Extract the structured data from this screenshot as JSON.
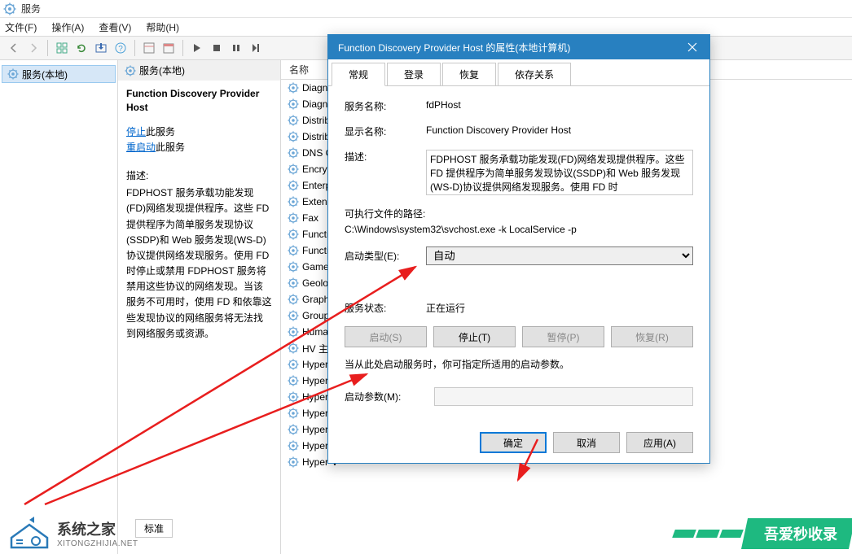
{
  "window": {
    "title": "服务",
    "menu": {
      "file": "文件(F)",
      "action": "操作(A)",
      "view": "查看(V)",
      "help": "帮助(H)"
    }
  },
  "tree": {
    "root": "服务(本地)"
  },
  "detail": {
    "header": "服务(本地)",
    "title": "Function Discovery Provider Host",
    "stop_link": "停止",
    "stop_suffix": "此服务",
    "restart_link": "重启动",
    "restart_suffix": "此服务",
    "desc_label": "描述:",
    "desc": "FDPHOST 服务承载功能发现(FD)网络发现提供程序。这些 FD 提供程序为简单服务发现协议(SSDP)和 Web 服务发现(WS-D)协议提供网络发现服务。使用 FD 时停止或禁用 FDPHOST 服务将禁用这些协议的网络发现。当该服务不可用时，使用 FD 和依靠这些发现协议的网络服务将无法找到网络服务或资源。"
  },
  "list": {
    "col_name": "名称",
    "items": [
      "Diagno",
      "Diagno",
      "Distribu",
      "Distribu",
      "DNS Cli",
      "Encrypt",
      "Enterpr",
      "Extensil",
      "Fax",
      "Functio",
      "Functio",
      "GameD",
      "Geoloc",
      "Graphi",
      "Group I",
      "Human",
      "HV 主机",
      "Hyper-",
      "Hyper-V",
      "Hyper-V",
      "Hyper-V",
      "Hyper-V",
      "Hyper-V",
      "Hyper-V"
    ]
  },
  "dialog": {
    "title": "Function Discovery Provider Host 的属性(本地计算机)",
    "tabs": {
      "general": "常规",
      "logon": "登录",
      "recovery": "恢复",
      "deps": "依存关系"
    },
    "svc_name_lbl": "服务名称:",
    "svc_name": "fdPHost",
    "disp_name_lbl": "显示名称:",
    "disp_name": "Function Discovery Provider Host",
    "desc_lbl": "描述:",
    "desc": "FDPHOST 服务承载功能发现(FD)网络发现提供程序。这些 FD 提供程序为简单服务发现协议(SSDP)和 Web 服务发现(WS-D)协议提供网络发现服务。使用 FD 时",
    "exe_lbl": "可执行文件的路径:",
    "exe": "C:\\Windows\\system32\\svchost.exe -k LocalService -p",
    "start_type_lbl": "启动类型(E):",
    "start_type": "自动",
    "status_lbl": "服务状态:",
    "status": "正在运行",
    "btn_start": "启动(S)",
    "btn_stop": "停止(T)",
    "btn_pause": "暂停(P)",
    "btn_resume": "恢复(R)",
    "hint": "当从此处启动服务时，你可指定所适用的启动参数。",
    "param_lbl": "启动参数(M):",
    "ok": "确定",
    "cancel": "取消",
    "apply": "应用(A)"
  },
  "watermark": {
    "cn": "系统之家",
    "en": "XITONGZHIJIA.NET",
    "right": "吾爱秒收录",
    "std": "标准"
  }
}
